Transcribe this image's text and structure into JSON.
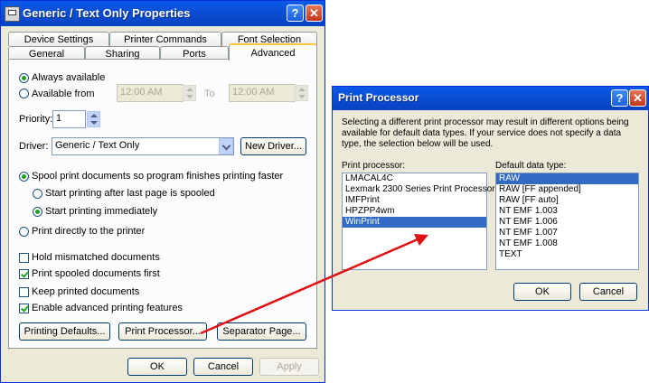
{
  "props_dialog": {
    "title": "Generic / Text Only Properties",
    "help_glyph": "?",
    "close_glyph": "✕",
    "tabs_row1": [
      "Device Settings",
      "Printer Commands",
      "Font Selection"
    ],
    "tabs_row2": [
      "General",
      "Sharing",
      "Ports",
      "Advanced"
    ],
    "active_tab": "Advanced",
    "always_available": "Always available",
    "available_from": "Available from",
    "from_time": "12:00 AM",
    "to_label": "To",
    "to_time": "12:00 AM",
    "priority_label": "Priority:",
    "priority_value": "1",
    "driver_label": "Driver:",
    "driver_value": "Generic / Text Only",
    "new_driver_button": "New Driver...",
    "spool_option": "Spool print documents so program finishes printing faster",
    "start_after_last": "Start printing after last page is spooled",
    "start_immediately": "Start printing immediately",
    "print_direct": "Print directly to the printer",
    "hold_mismatched": "Hold mismatched documents",
    "print_spooled_first": "Print spooled documents first",
    "keep_printed": "Keep printed documents",
    "enable_advanced": "Enable advanced printing features",
    "printing_defaults_button": "Printing Defaults...",
    "print_processor_button": "Print Processor...",
    "separator_page_button": "Separator Page...",
    "ok_button": "OK",
    "cancel_button": "Cancel",
    "apply_button": "Apply"
  },
  "processor_dialog": {
    "title": "Print Processor",
    "help_glyph": "?",
    "close_glyph": "✕",
    "description": "Selecting a different print processor may result in different options being available for default data types. If your service does not specify a data type, the selection below will be used.",
    "processor_label": "Print processor:",
    "processors": [
      "LMACAL4C",
      "Lexmark 2300 Series Print Processor",
      "IMFPrint",
      "HPZPP4wm",
      "WinPrint"
    ],
    "selected_processor": "WinPrint",
    "datatype_label": "Default data type:",
    "datatypes": [
      "RAW",
      "RAW [FF appended]",
      "RAW [FF auto]",
      "NT EMF 1.003",
      "NT EMF 1.006",
      "NT EMF 1.007",
      "NT EMF 1.008",
      "TEXT"
    ],
    "selected_datatype": "RAW",
    "ok_button": "OK",
    "cancel_button": "Cancel"
  },
  "colors": {
    "annotation_arrow": "#dd1111",
    "titlebar": "#0a4fd6",
    "selection": "#316ac5"
  },
  "icons": [
    "printer-icon",
    "help-icon",
    "close-icon",
    "spin-up-icon",
    "spin-down-icon",
    "dropdown-arrow-icon"
  ]
}
